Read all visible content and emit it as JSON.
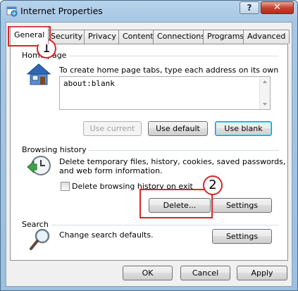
{
  "window": {
    "title": "Internet Properties",
    "help_label": "?",
    "close_label": "✕"
  },
  "tabs": [
    {
      "label": "General",
      "selected": true
    },
    {
      "label": "Security"
    },
    {
      "label": "Privacy"
    },
    {
      "label": "Content"
    },
    {
      "label": "Connections"
    },
    {
      "label": "Programs"
    },
    {
      "label": "Advanced"
    }
  ],
  "home_page": {
    "group_label": "Home page",
    "description": "To create home page tabs, type each address on its own line.",
    "value": "about:blank",
    "buttons": {
      "use_current": "Use current",
      "use_default": "Use default",
      "use_blank": "Use blank"
    }
  },
  "browsing_history": {
    "group_label": "Browsing history",
    "description_line1": "Delete temporary files, history, cookies, saved passwords,",
    "description_line2": "and web form information.",
    "checkbox_label": "Delete browsing history on exit",
    "checkbox_checked": false,
    "buttons": {
      "delete": "Delete...",
      "settings": "Settings"
    }
  },
  "search": {
    "group_label": "Search",
    "description": "Change search defaults.",
    "buttons": {
      "settings": "Settings"
    }
  },
  "footer": {
    "ok": "OK",
    "cancel": "Cancel",
    "apply": "Apply"
  },
  "annotations": {
    "step1": "1",
    "step2": "2",
    "color": "#d9262a"
  }
}
